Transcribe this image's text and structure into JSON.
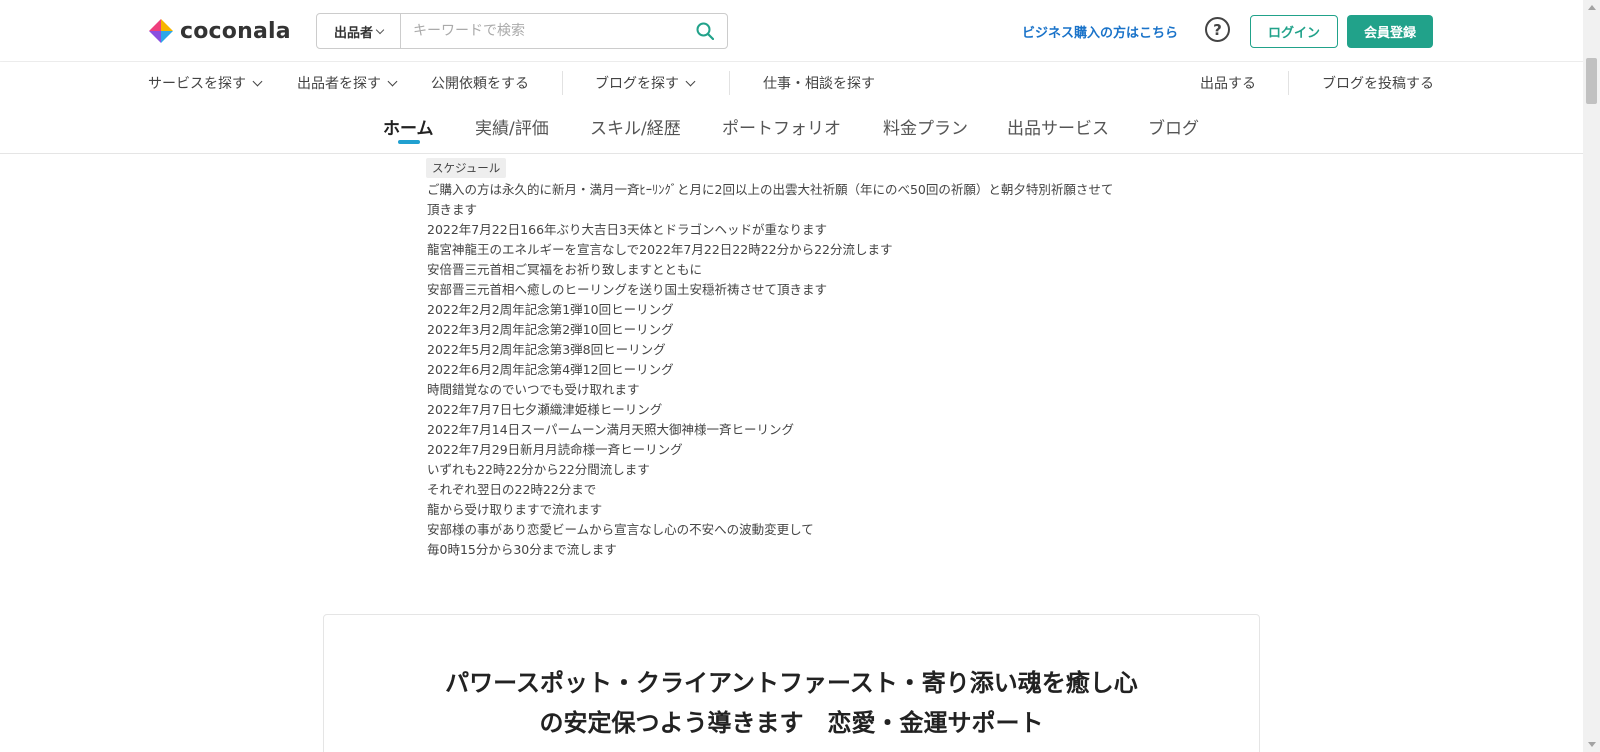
{
  "header": {
    "logo_text": "coconala",
    "search": {
      "category": "出品者",
      "placeholder": "キーワードで検索"
    },
    "business_link": "ビジネス購入の方はこちら",
    "help_glyph": "?",
    "login_label": "ログイン",
    "signup_label": "会員登録"
  },
  "nav": {
    "find_services": "サービスを探す",
    "find_sellers": "出品者を探す",
    "public_requests": "公開依頼をする",
    "find_blogs": "ブログを探す",
    "find_jobs": "仕事・相談を探す",
    "sell": "出品する",
    "post_blog": "ブログを投稿する"
  },
  "tabs": {
    "home": "ホーム",
    "results": "実績/評価",
    "skills": "スキル/経歴",
    "portfolio": "ポートフォリオ",
    "pricing": "料金プラン",
    "services": "出品サービス",
    "blog": "ブログ"
  },
  "content": {
    "schedule_tag": "スケジュール",
    "lines": [
      "ご購入の方は永久的に新月・満月一斉ﾋｰﾘﾝｸﾞと月に2回以上の出雲大社祈願（年にのべ50回の祈願）と朝夕特別祈願させて",
      "頂きます",
      "2022年7月22日166年ぶり大吉日3天体とドラゴンヘッドが重なります",
      "龍宮神龍王のエネルギーを宣言なしで2022年7月22日22時22分から22分流します",
      "安倍晋三元首相ご冥福をお祈り致しますとともに",
      "安部晋三元首相へ癒しのヒーリングを送り国土安穏祈祷させて頂きます",
      "2022年2月2周年記念第1弾10回ヒーリング",
      "2022年3月2周年記念第2弾10回ヒーリング",
      "2022年5月2周年記念第3弾8回ヒーリング",
      "2022年6月2周年記念第4弾12回ヒーリング",
      "時間錯覚なのでいつでも受け取れます",
      "2022年7月7日七夕瀬織津姫様ヒーリング",
      "2022年7月14日スーパームーン満月天照大御神様一斉ヒーリング",
      "2022年7月29日新月月読命様一斉ヒーリング",
      "いずれも22時22分から22分間流します",
      "それぞれ翌日の22時22分まで",
      "龍から受け取りますで流れます",
      "安部様の事があり恋愛ビームから宣言なし心の不安への波動変更して",
      "毎0時15分から30分まで流します"
    ]
  },
  "card": {
    "title_line1": "パワースポット・クライアントファースト・寄り添い魂を癒し心",
    "title_line2": "の安定保つよう導きます　恋愛・金運サポート"
  },
  "colors": {
    "brand_green": "#21a28a",
    "link_blue": "#1a73c9",
    "tab_accent": "#21a0d0"
  },
  "icons": {
    "search": "search-icon",
    "help": "help-icon",
    "logo": "coconala-logo-icon"
  }
}
